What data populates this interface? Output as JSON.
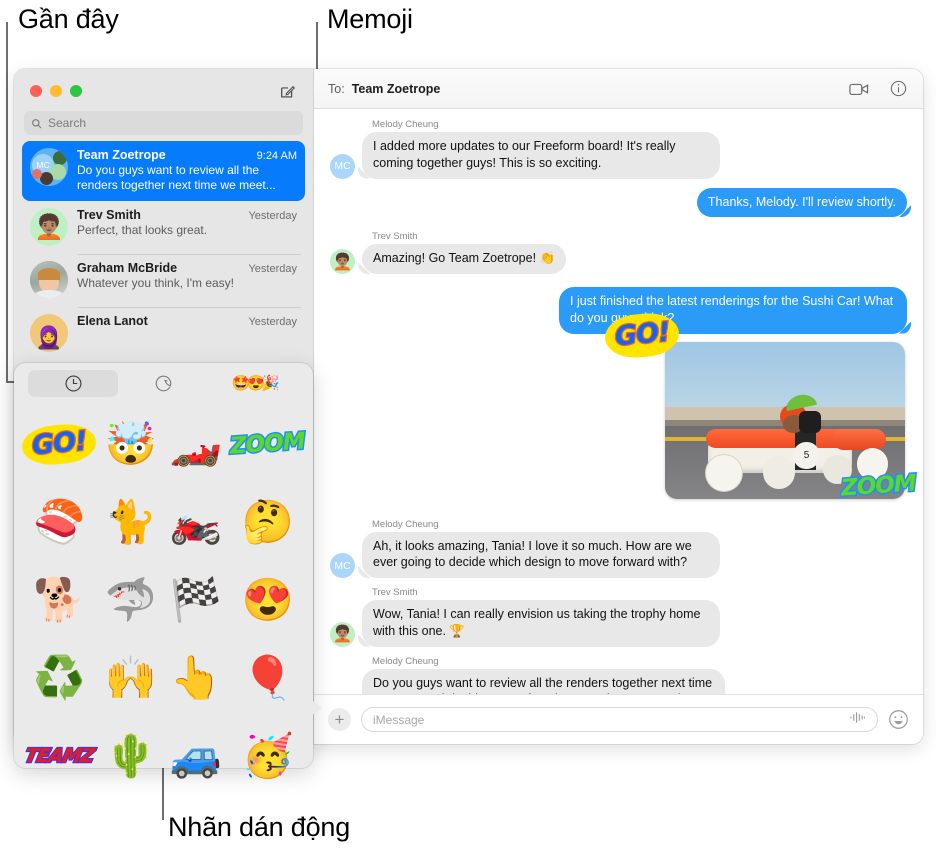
{
  "annotations": [
    {
      "id": "recents",
      "label": "Gần đây"
    },
    {
      "id": "memoji",
      "label": "Memoji"
    },
    {
      "id": "live-stickers",
      "label": "Nhãn dán động"
    }
  ],
  "window": {
    "traffic_lights": [
      "close",
      "minimize",
      "zoom"
    ],
    "compose_icon": "compose-icon"
  },
  "sidebar": {
    "search": {
      "placeholder": "Search",
      "icon": "search-icon"
    },
    "conversations": [
      {
        "name": "Team Zoetrope",
        "time": "9:24 AM",
        "preview": "Do you guys want to review all the renders together next time we meet...",
        "selected": true,
        "avatar": "group-avatar",
        "avatar_initials": "MC"
      },
      {
        "name": "Trev Smith",
        "time": "Yesterday",
        "preview": "Perfect, that looks great.",
        "selected": false,
        "avatar": "memoji-avatar-trev"
      },
      {
        "name": "Graham McBride",
        "time": "Yesterday",
        "preview": "Whatever you think, I'm easy!",
        "selected": false,
        "avatar": "photo-avatar-graham"
      },
      {
        "name": "Elena Lanot",
        "time": "Yesterday",
        "preview": "",
        "selected": false,
        "avatar": "photo-avatar-elena"
      }
    ]
  },
  "thread": {
    "to_label": "To:",
    "to_value": "Team Zoetrope",
    "facetime_icon": "video-camera-icon",
    "info_icon": "info-circle-icon",
    "messages": [
      {
        "sender": "Melody Cheung",
        "direction": "in",
        "avatar_initials": "MC",
        "text": "I added more updates to our Freeform board! It's really coming together guys! This is so exciting."
      },
      {
        "sender": "",
        "direction": "out",
        "text": "Thanks, Melody. I'll review shortly."
      },
      {
        "sender": "Trev Smith",
        "direction": "in",
        "avatar": "memoji-avatar-trev",
        "text": "Amazing! Go Team Zoetrope! 👏"
      },
      {
        "sender": "",
        "direction": "out",
        "text": "I just finished the latest renderings for the Sushi Car! What do you guys think?"
      },
      {
        "sender": "",
        "direction": "out",
        "type": "photo",
        "photo_caption": "sushi-race-car-photo",
        "stickers": [
          "GO!",
          "ZOOM"
        ]
      },
      {
        "sender": "Melody Cheung",
        "direction": "in",
        "avatar_initials": "MC",
        "text": "Ah, it looks amazing, Tania! I love it so much. How are we ever going to decide which design to move forward with?"
      },
      {
        "sender": "Trev Smith",
        "direction": "in",
        "avatar": "memoji-avatar-trev",
        "text": "Wow, Tania! I can really envision us taking the trophy home with this one. 🏆"
      },
      {
        "sender": "Melody Cheung",
        "direction": "in",
        "avatar_initials": "MC",
        "text": "Do you guys want to review all the renders together next time we meet and decide on our favorites? We have so much amazing work now, just need to make some decisions."
      }
    ],
    "composer": {
      "add_icon": "plus-circle-icon",
      "placeholder": "iMessage",
      "dictation_icon": "audio-waveform-icon",
      "emoji_icon": "smiley-face-icon"
    }
  },
  "sticker_panel": {
    "tabs": [
      {
        "id": "recents",
        "icon": "clock-icon",
        "active": true
      },
      {
        "id": "live-stickers",
        "icon": "sticker-peel-icon",
        "active": false
      },
      {
        "id": "memoji",
        "icon": "memoji-faces-icon",
        "active": false
      }
    ],
    "stickers": [
      {
        "name": "go-word-sticker",
        "kind": "word",
        "text": "GO!",
        "style": "ws-go"
      },
      {
        "name": "mind-blown-memoji-sticker",
        "kind": "emoji",
        "glyph": "🤯"
      },
      {
        "name": "racing-car-sticker",
        "kind": "emoji",
        "glyph": "🏎️"
      },
      {
        "name": "zoom-word-sticker",
        "kind": "word",
        "text": "ZOOM",
        "style": "ws-zoom"
      },
      {
        "name": "sushi-sticker",
        "kind": "emoji",
        "glyph": "🍣"
      },
      {
        "name": "grumpy-cat-sticker",
        "kind": "emoji",
        "glyph": "🐈"
      },
      {
        "name": "flaming-motorcycle-sticker",
        "kind": "emoji",
        "glyph": "🏍️"
      },
      {
        "name": "thinking-memoji-sticker",
        "kind": "emoji",
        "glyph": "🤔"
      },
      {
        "name": "dog-sunglasses-sticker",
        "kind": "emoji",
        "glyph": "🐕"
      },
      {
        "name": "shark-teeth-sticker",
        "kind": "emoji",
        "glyph": "🦈"
      },
      {
        "name": "checkered-flag-sticker",
        "kind": "emoji",
        "glyph": "🏁"
      },
      {
        "name": "heart-eyes-memoji-sticker",
        "kind": "emoji",
        "glyph": "😍"
      },
      {
        "name": "recycle-sticker",
        "kind": "emoji",
        "glyph": "♻️"
      },
      {
        "name": "heart-hands-memoji-sticker",
        "kind": "emoji",
        "glyph": "🙌"
      },
      {
        "name": "foam-finger-sticker",
        "kind": "emoji",
        "glyph": "👆"
      },
      {
        "name": "hot-air-balloon-sticker",
        "kind": "emoji",
        "glyph": "🎈"
      },
      {
        "name": "teamz-word-sticker",
        "kind": "word",
        "text": "TEAMZ",
        "style": "ws-teamz"
      },
      {
        "name": "cactus-sticker",
        "kind": "emoji",
        "glyph": "🌵"
      },
      {
        "name": "blue-car-sticker",
        "kind": "emoji",
        "glyph": "🚙"
      },
      {
        "name": "party-horn-memoji-sticker",
        "kind": "emoji",
        "glyph": "🥳"
      }
    ]
  }
}
